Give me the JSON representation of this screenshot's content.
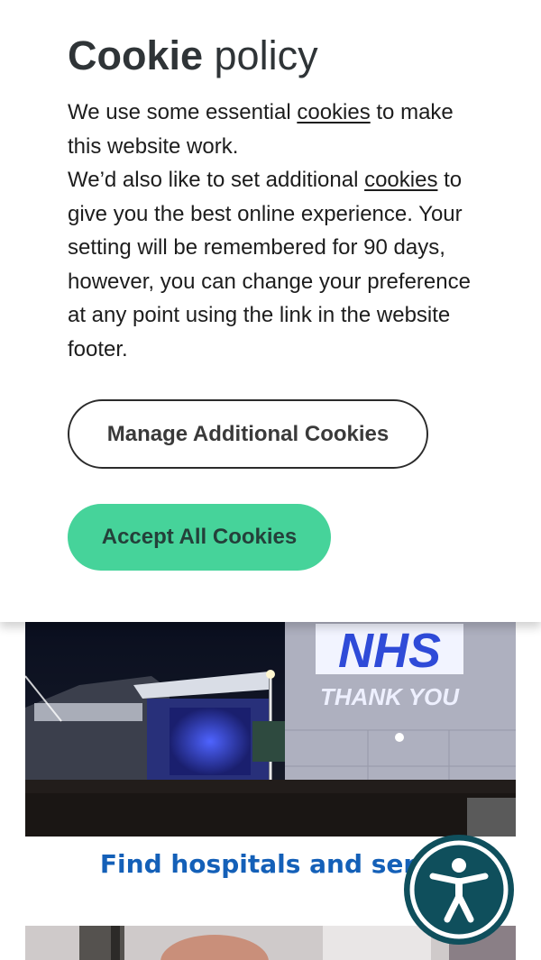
{
  "cookie_banner": {
    "title_bold": "Cookie",
    "title_rest": " policy",
    "line1_before": "We use some essential ",
    "line1_link": "cookies",
    "line1_after": " to make this website work.",
    "line2_before": "We’d also like to set additional ",
    "line2_link": "cookies",
    "line2_after": " to give you the best online experience. Your setting will be remembered for 90 days, however, you can change your preference at any point using the link in the website footer.",
    "manage_label": "Manage Additional Cookies",
    "accept_label": "Accept All Cookies",
    "accept_color": "#46d39a"
  },
  "hero": {
    "sign_line1": "NHS",
    "sign_line2": "THANK YOU",
    "link_text": "Find hospitals and servi"
  },
  "accessibility": {
    "icon": "accessibility-person-icon",
    "color": "#0f4f5c"
  }
}
